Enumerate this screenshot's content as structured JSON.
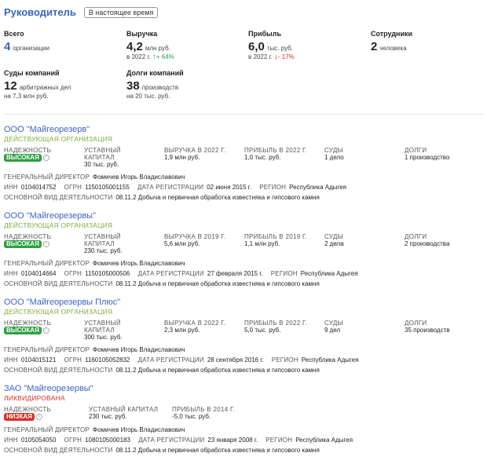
{
  "header": {
    "title": "Руководитель",
    "tag": "В настоящее время"
  },
  "summary": {
    "orgs": {
      "label": "Всего",
      "value": "4",
      "unit": "организации"
    },
    "revenue": {
      "label": "Выручка",
      "value": "4,2",
      "unit": "млн руб.",
      "sub": "в 2022 г.",
      "change": "+ 64%",
      "change_color": "#2ea043"
    },
    "profit": {
      "label": "Прибыль",
      "value": "6,0",
      "unit": "тыс. руб.",
      "sub": "в 2022 г.",
      "change": "- 17%",
      "change_color": "#d93025"
    },
    "employees": {
      "label": "Сотрудники",
      "value": "2",
      "unit": "человека"
    },
    "courts": {
      "label": "Суды компаний",
      "value": "12",
      "unit": "арбитражных дел",
      "sub": "на 7,3 млн руб."
    },
    "debts": {
      "label": "Долги компаний",
      "value": "38",
      "unit": "производств",
      "sub": "на 20 тыс. руб."
    }
  },
  "labels": {
    "reliability": "НАДЕЖНОСТЬ",
    "capital": "УСТАВНЫЙ КАПИТАЛ",
    "director": "ГЕНЕРАЛЬНЫЙ ДИРЕКТОР",
    "inn": "ИНН",
    "ogrn": "ОГРН",
    "reg_date": "ДАТА РЕГИСТРАЦИИ",
    "region": "РЕГИОН",
    "activity": "ОСНОВНОЙ ВИД ДЕЯТЕЛЬНОСТИ",
    "courts": "СУДЫ",
    "debts": "ДОЛГИ"
  },
  "companies": [
    {
      "name": "ООО \"Майгеорезерв\"",
      "status": "ДЕЙСТВУЮЩАЯ ОРГАНИЗАЦИЯ",
      "reliability": "ВЫСОКАЯ",
      "capital": "30 тыс. руб.",
      "revenue_label": "ВЫРУЧКА В 2022 Г.",
      "revenue": "1,9 млн руб.",
      "profit_label": "ПРИБЫЛЬ В 2022 Г.",
      "profit": "1,0 тыс. руб.",
      "courts": "1 дело",
      "debts": "1 производство",
      "director": "Фомичев Игорь Владиславович",
      "inn": "0104014752",
      "ogrn": "1150105001155",
      "reg_date": "02 июня 2015 г.",
      "region": "Республика Адыгея",
      "activity": "08.11.2 Добыча и первичная обработка известняка и гипсового камня"
    },
    {
      "name": "ООО \"Майгеорезервы\"",
      "status": "ДЕЙСТВУЮЩАЯ ОРГАНИЗАЦИЯ",
      "reliability": "ВЫСОКАЯ",
      "capital": "230 тыс. руб.",
      "revenue_label": "ВЫРУЧКА В 2019 Г.",
      "revenue": "5,6 млн руб.",
      "profit_label": "ПРИБЫЛЬ В 2019 Г.",
      "profit": "1,1 млн руб.",
      "courts": "2 дела",
      "debts": "2 производства",
      "director": "Фомичев Игорь Владиславович",
      "inn": "0104014664",
      "ogrn": "1150105000506",
      "reg_date": "27 февраля 2015 г.",
      "region": "Республика Адыгея",
      "activity": "08.11.2 Добыча и первичная обработка известняка и гипсового камня"
    },
    {
      "name": "ООО \"Майгеорезервы Плюс\"",
      "status": "ДЕЙСТВУЮЩАЯ ОРГАНИЗАЦИЯ",
      "reliability": "ВЫСОКАЯ",
      "capital": "300 тыс. руб.",
      "revenue_label": "ВЫРУЧКА В 2022 Г.",
      "revenue": "2,3 млн руб.",
      "profit_label": "ПРИБЫЛЬ В 2022 Г.",
      "profit": "5,0 тыс. руб.",
      "courts": "9 дел",
      "debts": "35 производств",
      "director": "Фомичев Игорь Владиславович",
      "inn": "0104015121",
      "ogrn": "1160105052832",
      "reg_date": "28 сентября 2016 г.",
      "region": "Республика Адыгея",
      "activity": "08.11.2 Добыча и первичная обработка известняка и гипсового камня"
    },
    {
      "name": "ЗАО \"Майгеорезервы\"",
      "status": "ЛИКВИДИРОВАНА",
      "reliability": "НИЗКАЯ",
      "capital": "230 тыс. руб.",
      "profit_label": "ПРИБЫЛЬ В 2014 Г.",
      "profit": "-5,0 тыс. руб.",
      "director": "Фомичев Игорь Владиславович",
      "inn": "0105054050",
      "ogrn": "1080105000183",
      "reg_date": "23 января 2008 г.",
      "region": "Республика Адыгея",
      "activity": "08.11.2 Добыча и первичная обработка известняка и гипсового камня"
    }
  ]
}
